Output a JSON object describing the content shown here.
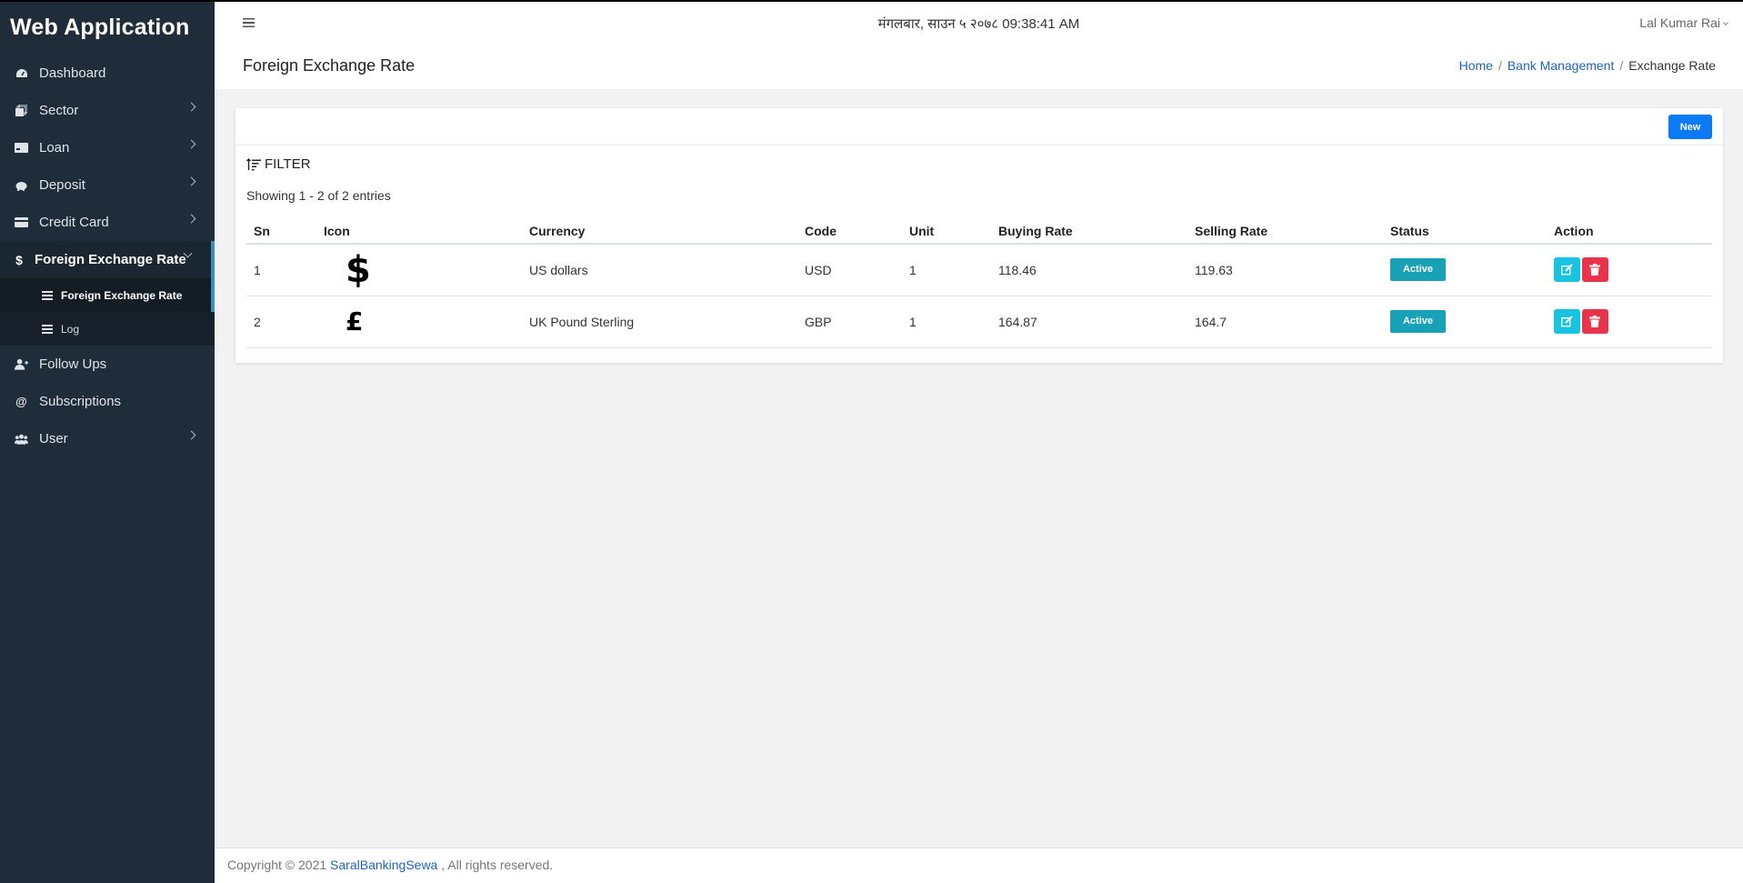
{
  "app": {
    "title": "Web Application"
  },
  "sidebar": {
    "items": [
      {
        "label": "Dashboard"
      },
      {
        "label": "Sector"
      },
      {
        "label": "Loan"
      },
      {
        "label": "Deposit"
      },
      {
        "label": "Credit Card"
      },
      {
        "label": "Foreign Exchange Rate"
      },
      {
        "label": "Follow Ups"
      },
      {
        "label": "Subscriptions"
      },
      {
        "label": "User"
      }
    ],
    "sub_items": [
      {
        "label": "Foreign Exchange Rate"
      },
      {
        "label": "Log"
      }
    ]
  },
  "topbar": {
    "datetime": "मंगलबार, साउन ५ २०७८ 09:38:41 AM",
    "user": "Lal Kumar Rai"
  },
  "page": {
    "title": "Foreign Exchange Rate",
    "breadcrumb": [
      "Home",
      "Bank Management",
      "Exchange Rate"
    ]
  },
  "card": {
    "new_label": "New",
    "filter_label": "FILTER",
    "entries_text": "Showing 1 - 2 of 2 entries"
  },
  "table": {
    "headers": [
      "Sn",
      "Icon",
      "Currency",
      "Code",
      "Unit",
      "Buying Rate",
      "Selling Rate",
      "Status",
      "Action"
    ],
    "rows": [
      {
        "sn": "1",
        "icon": "$",
        "currency": "US dollars",
        "code": "USD",
        "unit": "1",
        "buying": "118.46",
        "selling": "119.63",
        "status": "Active"
      },
      {
        "sn": "2",
        "icon": "£",
        "currency": "UK Pound Sterling",
        "code": "GBP",
        "unit": "1",
        "buying": "164.87",
        "selling": "164.7",
        "status": "Active"
      }
    ]
  },
  "footer": {
    "prefix": "Copyright © 2021 ",
    "link": "SaralBankingSewa",
    "suffix": " , All rights reserved."
  },
  "colors": {
    "sidebar_bg": "#1f2d3a",
    "primary_button": "#0b7bf5",
    "status_badge": "#17a2b8",
    "edit_button": "#17c3e0",
    "delete_button": "#e8334a",
    "link": "#1d64c1"
  },
  "icons": {
    "dashboard": "tachometer-icon",
    "sector": "layers-icon",
    "loan": "money-icon",
    "deposit": "piggy-bank-icon",
    "credit_card": "credit-card-icon",
    "forex": "dollar-icon",
    "follow_ups": "user-plus-icon",
    "subscriptions": "at-icon",
    "user": "users-icon"
  }
}
